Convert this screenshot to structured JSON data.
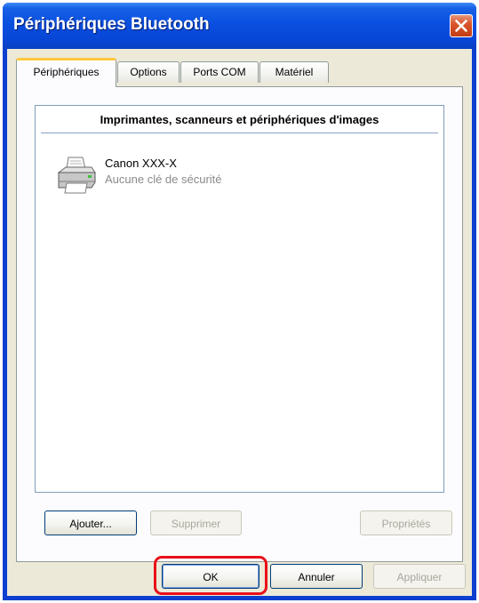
{
  "window": {
    "title": "Périphériques Bluetooth",
    "close_icon": "close-icon",
    "colors": {
      "title_bar": "#0a4fe0",
      "close_button": "#d9552c",
      "highlight": "#e8101a",
      "active_tab_accent": "#ffc83c"
    }
  },
  "tabs": [
    {
      "label": "Périphériques",
      "active": true
    },
    {
      "label": "Options",
      "active": false
    },
    {
      "label": "Ports COM",
      "active": false
    },
    {
      "label": "Matériel",
      "active": false
    }
  ],
  "device_list": {
    "group_header": "Imprimantes, scanneurs et périphériques d'images",
    "items": [
      {
        "name": "Canon XXX-X",
        "subtitle": "Aucune clé de sécurité",
        "icon": "printer-icon"
      }
    ]
  },
  "panel_buttons": {
    "add": "Ajouter...",
    "remove": "Supprimer",
    "properties": "Propriétés"
  },
  "dialog_buttons": {
    "ok": "OK",
    "cancel": "Annuler",
    "apply": "Appliquer"
  }
}
